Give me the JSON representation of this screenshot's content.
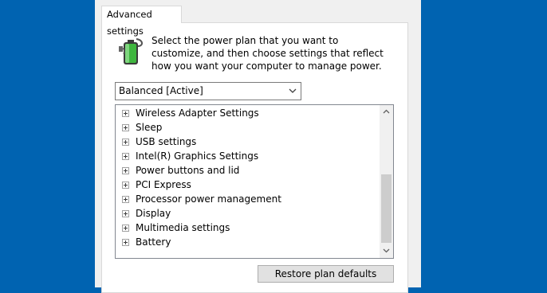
{
  "tab": {
    "label": "Advanced settings"
  },
  "description": "Select the power plan that you want to customize, and then choose settings that reflect how you want your computer to manage power.",
  "plan_select": {
    "value": "Balanced [Active]"
  },
  "tree": {
    "items": [
      {
        "label": "Wireless Adapter Settings"
      },
      {
        "label": "Sleep"
      },
      {
        "label": "USB settings"
      },
      {
        "label": "Intel(R) Graphics Settings"
      },
      {
        "label": "Power buttons and lid"
      },
      {
        "label": "PCI Express"
      },
      {
        "label": "Processor power management"
      },
      {
        "label": "Display"
      },
      {
        "label": "Multimedia settings"
      },
      {
        "label": "Battery"
      }
    ]
  },
  "buttons": {
    "restore": "Restore plan defaults"
  },
  "icons": {
    "battery": "battery-plug-icon",
    "expander": "plus-box-icon",
    "dropdown": "chevron-down-icon",
    "scroll_up": "chevron-up-icon",
    "scroll_down": "chevron-down-icon"
  },
  "colors": {
    "desktop": "#0063b1",
    "dialog": "#f0f0f0",
    "battery_green": "#3fb63f"
  }
}
